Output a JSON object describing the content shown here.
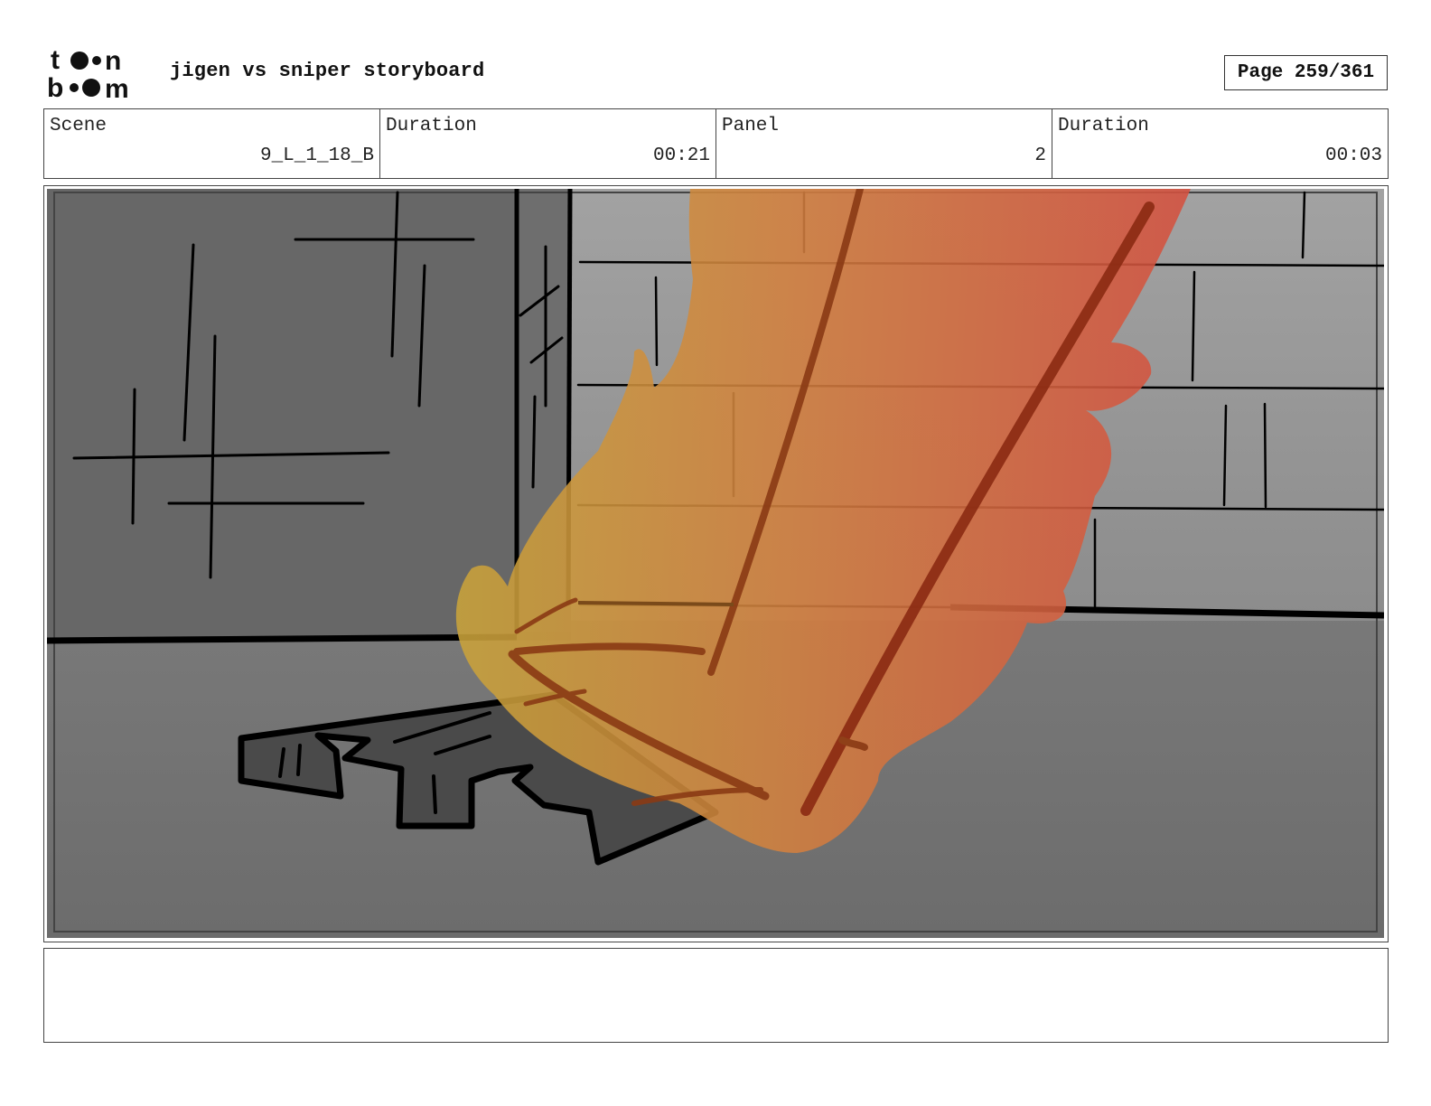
{
  "header": {
    "logo_text": "toon boom",
    "title": "jigen vs sniper storyboard",
    "page_indicator": "Page 259/361"
  },
  "info": {
    "scene_label": "Scene",
    "scene_value": "9_L_1_18_B",
    "scene_duration_label": "Duration",
    "scene_duration_value": "00:21",
    "panel_label": "Panel",
    "panel_value": "2",
    "panel_duration_label": "Duration",
    "panel_duration_value": "00:03"
  },
  "panel": {
    "description_icon": "burning-debris-sketch",
    "colors": {
      "wall_dark": "#676767",
      "wall_light": "#9e9e9e",
      "floor": "#7e7e7e",
      "flame_yellow": "#c9a33a",
      "flame_orange": "#d2803f",
      "flame_red": "#d4503f",
      "ink": "#000000"
    }
  },
  "notes": {
    "text": ""
  }
}
